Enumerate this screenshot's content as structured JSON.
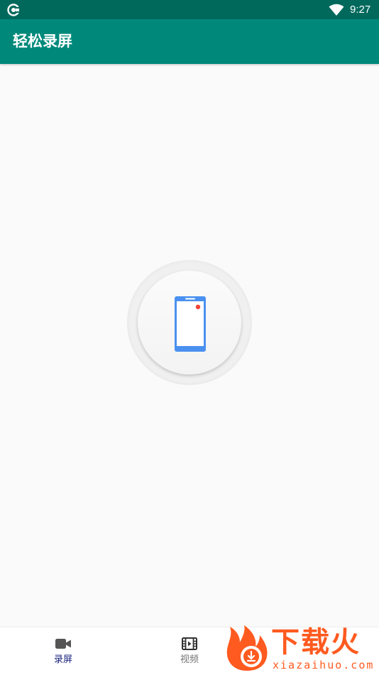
{
  "status_bar": {
    "time": "9:27",
    "app_icon": "screen-record-notification-icon",
    "wifi_icon": "wifi-full-icon",
    "background": "#00695c"
  },
  "app_bar": {
    "title": "轻松录屏",
    "background": "#00897b"
  },
  "main": {
    "record_button_icon": "phone-recording-icon",
    "phone_color": "#4a90f0",
    "record_dot_color": "#f44336"
  },
  "bottom_nav": {
    "items": [
      {
        "label": "录屏",
        "icon": "video-camera-icon",
        "active": true,
        "color": "#1a237e"
      },
      {
        "label": "视频",
        "icon": "film-strip-icon",
        "active": false,
        "color": "#757575"
      }
    ]
  },
  "watermark": {
    "text": "下载火",
    "subtext": "xiazaihuo.com",
    "color": "#ff5a1f"
  }
}
